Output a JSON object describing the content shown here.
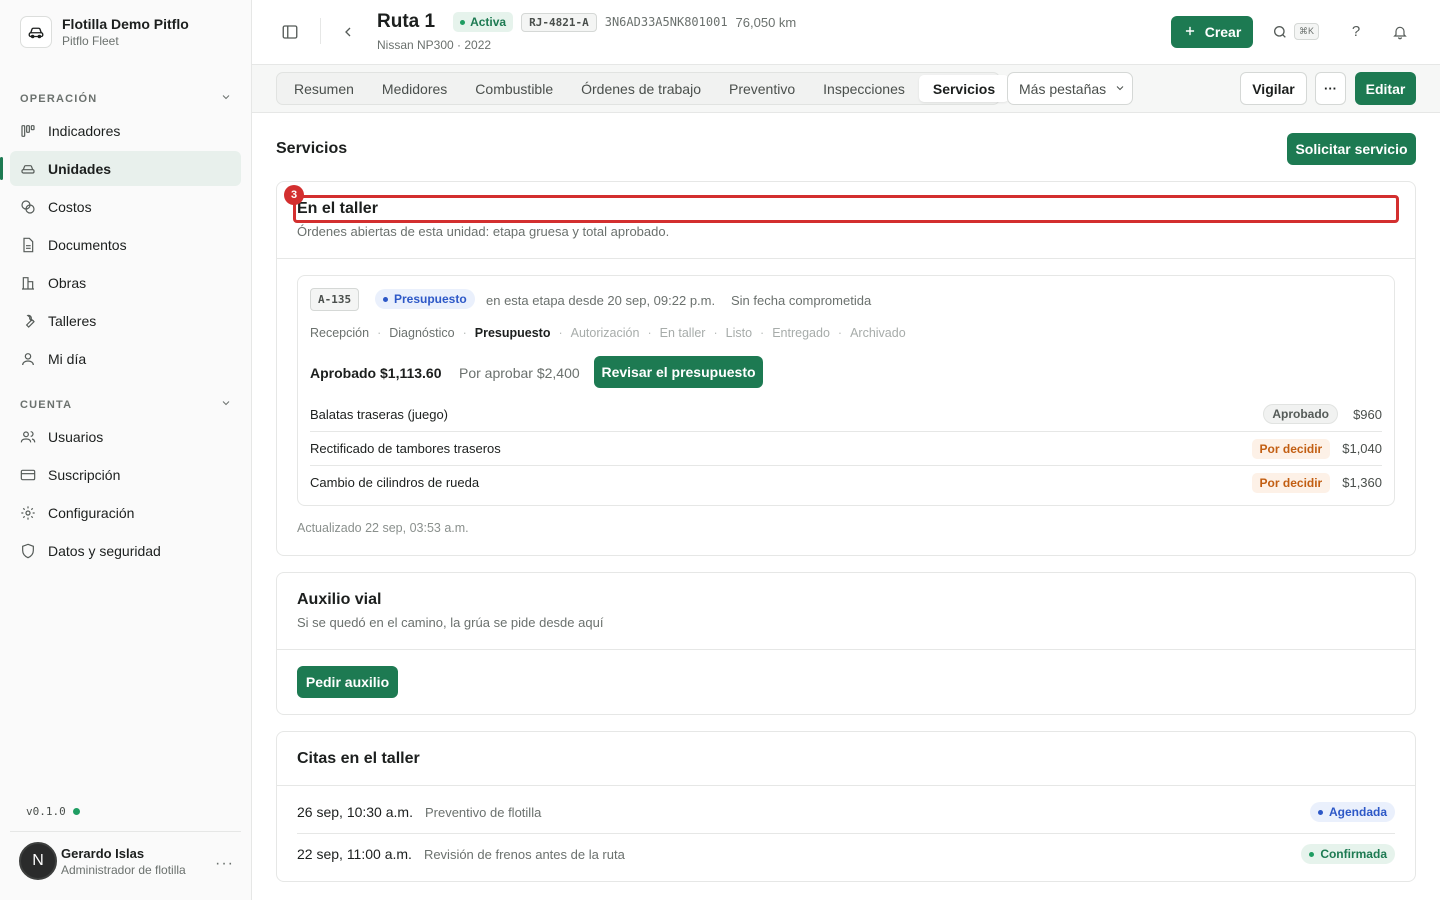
{
  "org": {
    "name": "Flotilla Demo Pitflo",
    "subtitle": "Pitflo Fleet",
    "logo_icon": "car-icon"
  },
  "sidebar": {
    "sections": [
      {
        "label": "OPERACIÓN",
        "items": [
          {
            "label": "Indicadores",
            "icon": "chart-icon"
          },
          {
            "label": "Unidades",
            "icon": "car-icon",
            "active": true
          },
          {
            "label": "Costos",
            "icon": "coins-icon"
          },
          {
            "label": "Documentos",
            "icon": "document-icon"
          },
          {
            "label": "Obras",
            "icon": "building-icon"
          },
          {
            "label": "Talleres",
            "icon": "wrench-icon"
          },
          {
            "label": "Mi día",
            "icon": "user-icon"
          }
        ]
      },
      {
        "label": "CUENTA",
        "items": [
          {
            "label": "Usuarios",
            "icon": "users-icon"
          },
          {
            "label": "Suscripción",
            "icon": "card-icon"
          },
          {
            "label": "Configuración",
            "icon": "gear-icon"
          },
          {
            "label": "Datos y seguridad",
            "icon": "shield-icon"
          }
        ]
      }
    ],
    "version": "v0.1.0",
    "user": {
      "initial": "N",
      "name": "Gerardo Islas",
      "role": "Administrador de flotilla",
      "more": "···"
    }
  },
  "header": {
    "title": "Ruta 1",
    "status": "Activa",
    "plate": "RJ-4821-A",
    "vin": "3N6AD33A5NK801001",
    "km": "76,050 km",
    "subtitle": "Nissan NP300 · 2022",
    "create_label": "Crear",
    "shortcut": "⌘K",
    "help": "?"
  },
  "tabs": {
    "items": [
      "Resumen",
      "Medidores",
      "Combustible",
      "Órdenes de trabajo",
      "Preventivo",
      "Inspecciones",
      "Servicios"
    ],
    "active_index": 6,
    "more_label": "Más pestañas",
    "watch_label": "Vigilar",
    "more_actions": "···",
    "edit_label": "Editar"
  },
  "main": {
    "title": "Servicios",
    "request_label": "Solicitar servicio",
    "marker": "3",
    "workshop": {
      "title": "En el taller",
      "desc": "Órdenes abiertas de esta unidad: etapa gruesa y total aprobado.",
      "order": {
        "code": "A-135",
        "stage_badge": "Presupuesto",
        "since": "en esta etapa desde 20 sep, 09:22 p.m.",
        "commit": "Sin fecha comprometida",
        "stages": [
          {
            "label": "Recepción",
            "state": "done"
          },
          {
            "label": "Diagnóstico",
            "state": "done"
          },
          {
            "label": "Presupuesto",
            "state": "current"
          },
          {
            "label": "Autorización",
            "state": "future"
          },
          {
            "label": "En taller",
            "state": "future"
          },
          {
            "label": "Listo",
            "state": "future"
          },
          {
            "label": "Entregado",
            "state": "future"
          },
          {
            "label": "Archivado",
            "state": "future"
          }
        ],
        "approved": "Aprobado $1,113.60",
        "pending": "Por aprobar $2,400",
        "review_label": "Revisar el presupuesto",
        "items": [
          {
            "name": "Balatas traseras (juego)",
            "status": "Aprobado",
            "price": "$960"
          },
          {
            "name": "Rectificado de tambores traseros",
            "status": "Por decidir",
            "price": "$1,040"
          },
          {
            "name": "Cambio de cilindros de rueda",
            "status": "Por decidir",
            "price": "$1,360"
          }
        ]
      },
      "updated": "Actualizado 22 sep, 03:53 a.m."
    },
    "roadside": {
      "title": "Auxilio vial",
      "desc": "Si se quedó en el camino, la grúa se pide desde aquí",
      "button": "Pedir auxilio"
    },
    "appointments": {
      "title": "Citas en el taller",
      "items": [
        {
          "date": "26 sep, 10:30 a.m.",
          "desc": "Preventivo de flotilla",
          "status": "Agendada",
          "color": "blue"
        },
        {
          "date": "22 sep, 11:00 a.m.",
          "desc": "Revisión de frenos antes de la ruta",
          "status": "Confirmada",
          "color": "green"
        }
      ]
    }
  },
  "colors": {
    "brand": "#1d7a52",
    "highlight": "#d32f2f"
  }
}
